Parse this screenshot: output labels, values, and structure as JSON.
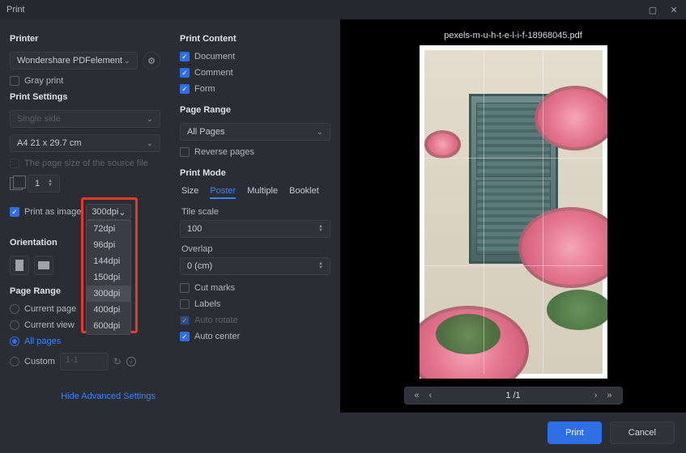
{
  "window": {
    "title": "Print"
  },
  "left": {
    "printer_head": "Printer",
    "printer_value": "Wondershare PDFelement",
    "gray_print": "Gray print",
    "settings_head": "Print Settings",
    "duplex_placeholder": "Single side",
    "paper_size": "A4 21 x 29.7 cm",
    "source_size_label": "The page size of the source file",
    "copies_value": "1",
    "print_as_image_label": "Print as image",
    "dpi_selected": "300dpi",
    "dpi_options": [
      "72dpi",
      "96dpi",
      "144dpi",
      "150dpi",
      "300dpi",
      "400dpi",
      "600dpi"
    ],
    "orientation_head": "Orientation",
    "range_head": "Page Range",
    "range_current_page": "Current page",
    "range_current_view": "Current view",
    "range_all_pages": "All pages",
    "range_custom": "Custom",
    "range_custom_placeholder": "1-1",
    "advanced_link": "Hide Advanced Settings"
  },
  "mid": {
    "content_head": "Print Content",
    "doc": "Document",
    "comment": "Comment",
    "form": "Form",
    "range_head": "Page Range",
    "all_pages": "All Pages",
    "reverse": "Reverse pages",
    "mode_head": "Print Mode",
    "tabs": {
      "size": "Size",
      "poster": "Poster",
      "multiple": "Multiple",
      "booklet": "Booklet"
    },
    "tile_scale_label": "Tile scale",
    "tile_scale_value": "100",
    "overlap_label": "Overlap",
    "overlap_value": "0 (cm)",
    "cut_marks": "Cut marks",
    "labels": "Labels",
    "auto_rotate": "Auto rotate",
    "auto_center": "Auto center"
  },
  "right": {
    "filename": "pexels-m-u-h-t-e-l-i-f-18968045.pdf",
    "page_indicator": "1 /1"
  },
  "footer": {
    "print": "Print",
    "cancel": "Cancel"
  }
}
